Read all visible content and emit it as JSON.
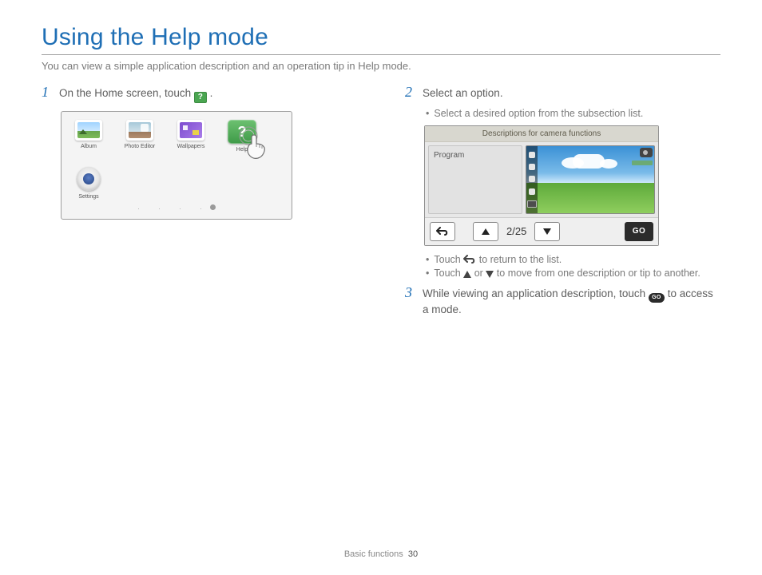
{
  "title": "Using the Help mode",
  "subtitle": "You can view a simple application description and an operation tip in Help mode.",
  "steps": {
    "s1": {
      "num": "1",
      "text_a": "On the Home screen, touch ",
      "text_b": "."
    },
    "s2": {
      "num": "2",
      "text": "Select an option.",
      "bullets": {
        "b1": "Select a desired option from the subsection list.",
        "b2a": "Touch ",
        "b2b": " to return to the list.",
        "b3a": "Touch ",
        "b3b": " or ",
        "b3c": " to move from one description or tip to another."
      }
    },
    "s3": {
      "num": "3",
      "text_a": "While viewing an application description, touch ",
      "text_b": " to access a mode."
    }
  },
  "home_screen": {
    "apps": {
      "album": "Album",
      "photo_editor": "Photo Editor",
      "wallpapers": "Wallpapers",
      "help": "Help",
      "settings": "Settings"
    }
  },
  "camera_card": {
    "header": "Descriptions for camera functions",
    "mode": "Program",
    "counter": "2/25",
    "go": "GO"
  },
  "footer": {
    "section": "Basic functions",
    "page": "30"
  }
}
